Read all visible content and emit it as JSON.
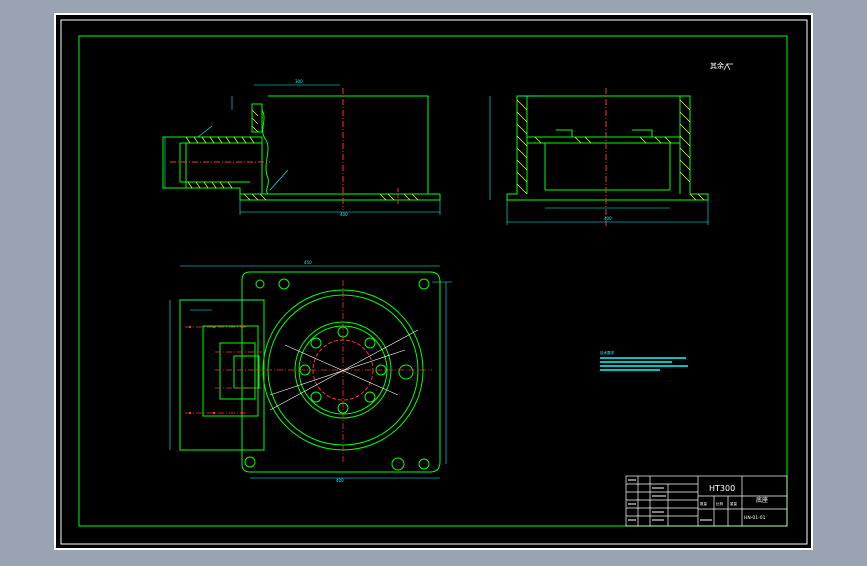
{
  "viewport": {
    "background": "#000000",
    "frame_color": "#ffffff",
    "page_background": "#9aa3b2"
  },
  "colors": {
    "geometry": "#00ff00",
    "centerline": "#ff3030",
    "dimension": "#00ffff",
    "hatch": "#ffff00",
    "border": "#00ff00",
    "text_white": "#ffffff",
    "hidden": "#ffff00"
  },
  "title_block": {
    "material": "HT300",
    "part_name": "底座",
    "drawing_number": "HN-01-01",
    "label_scale": "比例",
    "label_qty": "数量",
    "label_weight": "重量"
  },
  "corner_mark": "其余",
  "notes_title": "技术要求"
}
